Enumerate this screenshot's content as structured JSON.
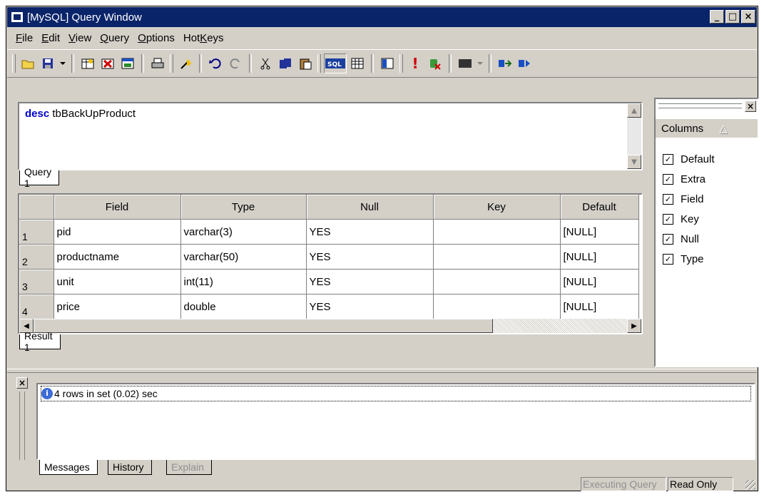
{
  "window": {
    "title": "[MySQL] Query Window",
    "controls": {
      "minimize": "_",
      "maximize": "□",
      "close": "×"
    }
  },
  "menu": [
    {
      "pre": "",
      "u": "F",
      "post": "ile"
    },
    {
      "pre": "",
      "u": "E",
      "post": "dit"
    },
    {
      "pre": "",
      "u": "V",
      "post": "iew"
    },
    {
      "pre": "",
      "u": "Q",
      "post": "uery"
    },
    {
      "pre": "",
      "u": "O",
      "post": "ptions"
    },
    {
      "pre": "Hot",
      "u": "K",
      "post": "eys"
    }
  ],
  "query": {
    "keyword": "desc",
    "text": " tbBackUpProduct",
    "tab_label": "Query 1"
  },
  "result": {
    "columns": [
      "Field",
      "Type",
      "Null",
      "Key",
      "Default"
    ],
    "rows": [
      {
        "num": "1",
        "field": "pid",
        "type": "varchar(3)",
        "null": "YES",
        "key": "",
        "default": "[NULL]"
      },
      {
        "num": "2",
        "field": "productname",
        "type": "varchar(50)",
        "null": "YES",
        "key": "",
        "default": "[NULL]"
      },
      {
        "num": "3",
        "field": "unit",
        "type": "int(11)",
        "null": "YES",
        "key": "",
        "default": "[NULL]"
      },
      {
        "num": "4",
        "field": "price",
        "type": "double",
        "null": "YES",
        "key": "",
        "default": "[NULL]"
      }
    ],
    "tab_label": "Result 1"
  },
  "columns_panel": {
    "header": "Columns",
    "sort_icon": "△",
    "items": [
      "Default",
      "Extra",
      "Field",
      "Key",
      "Null",
      "Type"
    ],
    "checked_mark": "☑"
  },
  "messages": {
    "text": "4 rows in set (0.02) sec",
    "tabs": [
      "Messages",
      "History",
      "Explain"
    ]
  },
  "status": {
    "executing": "Executing Query",
    "readonly": "Read Only"
  },
  "colors": {
    "titlebar": "#0a246a",
    "keyword": "#0000cc",
    "face": "#d4d0c8"
  }
}
